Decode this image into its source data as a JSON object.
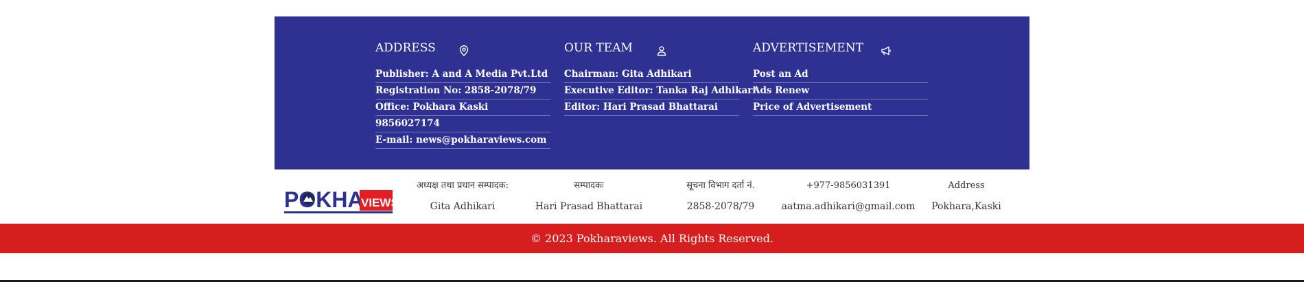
{
  "colors": {
    "footer_bg": "#2e3192",
    "copyright_bg": "#d71e1e",
    "logo_red": "#e31e24",
    "logo_blue": "#2e3192"
  },
  "address": {
    "title": "ADDRESS",
    "icon": "map-pin-icon",
    "items": [
      "Publisher: A and A Media Pvt.Ltd",
      "Registration No: 2858-2078/79",
      "Office: Pokhara Kaski",
      "9856027174",
      "E-mail: news@pokharaviews.com"
    ]
  },
  "team": {
    "title": "OUR TEAM",
    "icon": "user-icon",
    "items": [
      "Chairman: Gita Adhikari",
      "Executive Editor: Tanka Raj Adhikari",
      "Editor: Hari Prasad Bhattarai"
    ]
  },
  "ads": {
    "title": "ADVERTISEMENT",
    "icon": "megaphone-icon",
    "items": [
      "Post an Ad",
      "Ads Renew",
      "Price of Advertisement"
    ]
  },
  "logo": {
    "text_main": "POKHARA",
    "text_side": "VIEWS"
  },
  "info": [
    {
      "label": "अध्यक्ष तथा प्रधान सम्पादक:",
      "value": "Gita Adhikari"
    },
    {
      "label": "सम्पादकः",
      "value": "Hari Prasad Bhattarai"
    },
    {
      "label": "सूचना विभाग दर्ता नं.",
      "value": "2858-2078/79"
    },
    {
      "label": "+977-9856031391",
      "value": "aatma.adhikari@gmail.com"
    },
    {
      "label": "Address",
      "value": "Pokhara,Kaski"
    }
  ],
  "copyright": "© 2023 Pokharaviews. All Rights Reserved."
}
